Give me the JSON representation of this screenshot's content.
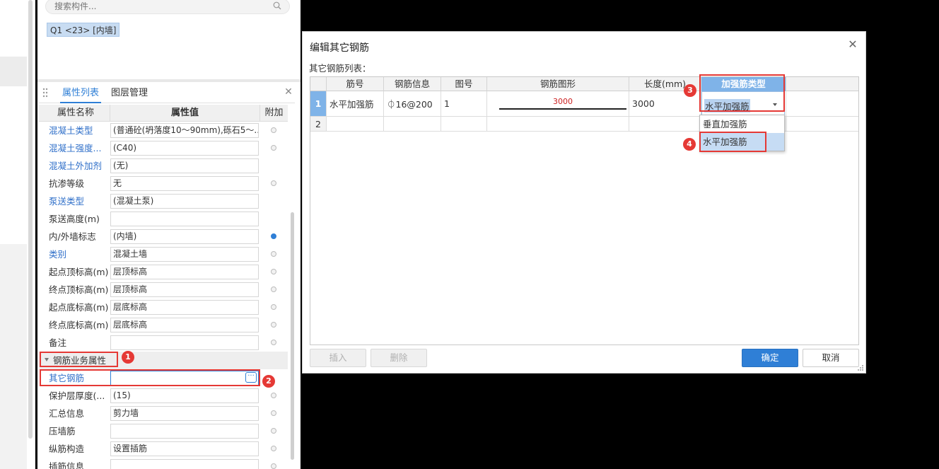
{
  "search": {
    "placeholder": "搜索构件..."
  },
  "component_chip": "Q1 <23> [内墙]",
  "tabs": [
    {
      "label": "属性列表",
      "active": true
    },
    {
      "label": "图层管理",
      "active": false
    }
  ],
  "prop_header": {
    "name": "属性名称",
    "value": "属性值",
    "add": "附加"
  },
  "props": [
    {
      "name": "混凝土类型",
      "value": "(普通砼(坍落度10～90mm),砾石5～...",
      "link": true,
      "dot": "off"
    },
    {
      "name": "混凝土强度...",
      "value": "(C40)",
      "link": true,
      "dot": "off"
    },
    {
      "name": "混凝土外加剂",
      "value": "(无)",
      "link": true,
      "dot": "none"
    },
    {
      "name": "抗渗等级",
      "value": "无",
      "link": false,
      "dot": "off"
    },
    {
      "name": "泵送类型",
      "value": "(混凝土泵)",
      "link": true,
      "dot": "none"
    },
    {
      "name": "泵送高度(m)",
      "value": "",
      "link": false,
      "dot": "none"
    },
    {
      "name": "内/外墙标志",
      "value": "(内墙)",
      "link": false,
      "dot": "on"
    },
    {
      "name": "类别",
      "value": "混凝土墙",
      "link": true,
      "dot": "off"
    },
    {
      "name": "起点顶标高(m)",
      "value": "层顶标高",
      "link": false,
      "dot": "off"
    },
    {
      "name": "终点顶标高(m)",
      "value": "层顶标高",
      "link": false,
      "dot": "off"
    },
    {
      "name": "起点底标高(m)",
      "value": "层底标高",
      "link": false,
      "dot": "off"
    },
    {
      "name": "终点底标高(m)",
      "value": "层底标高",
      "link": false,
      "dot": "off"
    },
    {
      "name": "备注",
      "value": "",
      "link": false,
      "dot": "off"
    }
  ],
  "group": {
    "label": "钢筋业务属性"
  },
  "group_props": [
    {
      "name": "其它钢筋",
      "value": "",
      "link": true,
      "dot": "none",
      "ellipsis": "···"
    },
    {
      "name": "保护层厚度(...",
      "value": "(15)",
      "link": false,
      "dot": "off"
    },
    {
      "name": "汇总信息",
      "value": "剪力墙",
      "link": false,
      "dot": "off"
    },
    {
      "name": "压墙筋",
      "value": "",
      "link": false,
      "dot": "off"
    },
    {
      "name": "纵筋构造",
      "value": "设置插筋",
      "link": false,
      "dot": "off"
    },
    {
      "name": "插筋信息",
      "value": "",
      "link": false,
      "dot": "off"
    }
  ],
  "badges": [
    "1",
    "2",
    "3",
    "4"
  ],
  "dialog": {
    "title": "编辑其它钢筋",
    "list_label": "其它钢筋列表：",
    "columns": [
      "筋号",
      "钢筋信息",
      "图号",
      "钢筋图形",
      "长度(mm)",
      "加强筋类型"
    ],
    "rows": [
      {
        "no": "1",
        "name": "水平加强筋",
        "info": "⏀16@200",
        "fig": "1",
        "shape_value": "3000",
        "length": "3000",
        "type": "水平加强筋"
      },
      {
        "no": "2",
        "name": "",
        "info": "",
        "fig": "",
        "shape_value": "",
        "length": "",
        "type": ""
      }
    ],
    "dropdown_options": [
      "垂直加强筋",
      "水平加强筋"
    ],
    "buttons": {
      "insert": "插入",
      "delete": "删除",
      "ok": "确定",
      "cancel": "取消"
    }
  },
  "colors": {
    "accent": "#2f7fd6",
    "highlight": "#e53935",
    "link": "#2f6fc9"
  }
}
